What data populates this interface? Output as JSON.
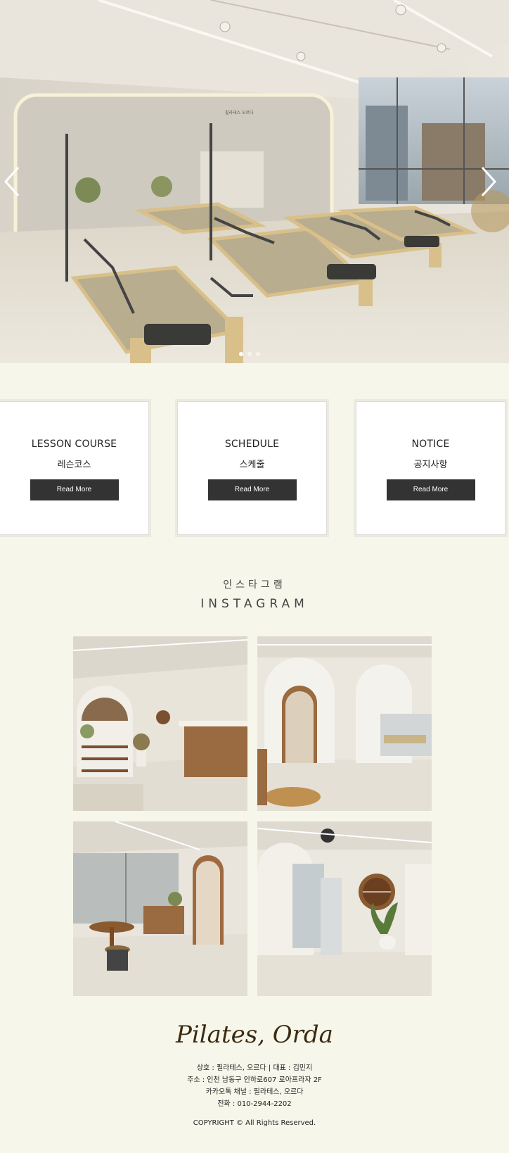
{
  "hero": {
    "image": "pilates-studio-reformer-room",
    "arrows": {
      "prev": "chevron-left-icon",
      "next": "chevron-right-icon"
    },
    "slide_count": 3,
    "active_slide": 1,
    "wall_sign": "필라테스 오르다"
  },
  "cards": [
    {
      "title": "LESSON COURSE",
      "subtitle": "레슨코스",
      "button": "Read More"
    },
    {
      "title": "SCHEDULE",
      "subtitle": "스케줄",
      "button": "Read More"
    },
    {
      "title": "NOTICE",
      "subtitle": "공지사항",
      "button": "Read More"
    }
  ],
  "instagram": {
    "title_ko": "인스타그램",
    "title_en": "INSTAGRAM",
    "photos": [
      "lobby-reception",
      "arched-hallway",
      "lounge-area",
      "round-window-corridor"
    ]
  },
  "footer": {
    "logo": "Pilates, Orda",
    "business": "상호 : 필라테스, 오르다 | 대표 : 김민지",
    "address": "주소 : 인천 남동구 인하로607 로아프라자 2F",
    "kakao": "카카오톡 채널 : 필라테스, 오르다",
    "phone": "전화 : 010-2944-2202",
    "copyright": "COPYRIGHT © All Rights Reserved."
  },
  "colors": {
    "background": "#f6f6ea",
    "button": "#333333",
    "logo": "#3b2a12",
    "wood": "#d9c08a"
  }
}
